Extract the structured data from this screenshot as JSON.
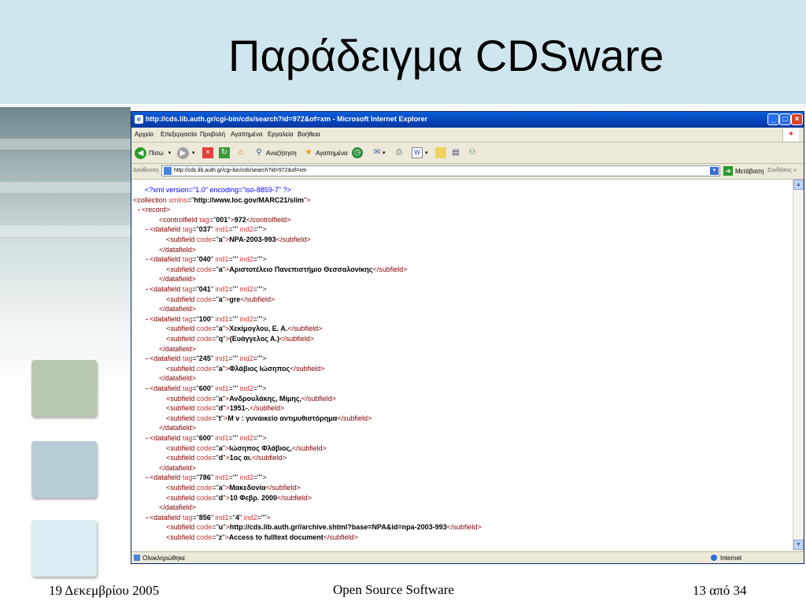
{
  "slide": {
    "title": "Παράδειγμα CDSware",
    "footer_left": "19 Δεκεμβρίου 2005",
    "footer_center": "Open Source Software",
    "footer_right": "13 από 34"
  },
  "browser": {
    "title": "http://cds.lib.auth.gr/cgi-bin/cds/search?id=972&of=xm - Microsoft Internet Explorer",
    "menu": [
      "Αρχείο",
      "Επεξεργασία",
      "Προβολή",
      "Αγαπημένα",
      "Εργαλεία",
      "Βοήθεια"
    ],
    "toolbar": {
      "back_label": "Πίσω",
      "search_label": "Αναζήτηση",
      "favorites_label": "Αγαπημένα"
    },
    "address": {
      "label": "Διεύθυνση",
      "value": "http://cds.lib.auth.gr/cgi-bin/cds/search?id=972&of=xm",
      "go_label": "Μετάβαση",
      "links_label": "Συνδέσεις"
    },
    "status": {
      "left": "Ολοκληρώθηκε",
      "zone": "Internet"
    }
  },
  "xml_lines": [
    {
      "indent": 1,
      "marker": "",
      "html": "<span class=\"pi\">&lt;?xml version=\"1.0\" encoding=\"iso-8859-7\" ?&gt;</span>"
    },
    {
      "indent": 0,
      "marker": "-",
      "html": "<span class=\"t\">&lt;collection</span> <span class=\"a\">xmlns</span>=\"<span class=\"v\">http://www.loc.gov/MARC21/slim</span>\"<span class=\"t\">&gt;</span>"
    },
    {
      "indent": 1,
      "marker": "-",
      "html": "<span class=\"t\">&lt;record&gt;</span>"
    },
    {
      "indent": 3,
      "marker": "",
      "html": "<span class=\"t\">&lt;controlfield</span> <span class=\"a\">tag</span>=\"<span class=\"v\">001</span>\"<span class=\"t\">&gt;</span><span class=\"tx\">972</span><span class=\"t\">&lt;/controlfield&gt;</span>"
    },
    {
      "indent": 2,
      "marker": "-",
      "html": "<span class=\"t\">&lt;datafield</span> <span class=\"a\">tag</span>=\"<span class=\"v\">037</span>\" <span class=\"a\">ind1</span>=\"\" <span class=\"a\">ind2</span>=\"\"<span class=\"t\">&gt;</span>"
    },
    {
      "indent": 4,
      "marker": "",
      "html": "<span class=\"t\">&lt;subfield</span> <span class=\"a\">code</span>=\"<span class=\"v\">a</span>\"<span class=\"t\">&gt;</span><span class=\"tx\">NPA-2003-993</span><span class=\"t\">&lt;/subfield&gt;</span>"
    },
    {
      "indent": 3,
      "marker": "",
      "html": "<span class=\"t\">&lt;/datafield&gt;</span>"
    },
    {
      "indent": 2,
      "marker": "-",
      "html": "<span class=\"t\">&lt;datafield</span> <span class=\"a\">tag</span>=\"<span class=\"v\">040</span>\" <span class=\"a\">ind1</span>=\"\" <span class=\"a\">ind2</span>=\"\"<span class=\"t\">&gt;</span>"
    },
    {
      "indent": 4,
      "marker": "",
      "html": "<span class=\"t\">&lt;subfield</span> <span class=\"a\">code</span>=\"<span class=\"v\">a</span>\"<span class=\"t\">&gt;</span><span class=\"tx\">Αριστοτέλειο Πανεπιστήμιο Θεσσαλονίκης</span><span class=\"t\">&lt;/subfield&gt;</span>"
    },
    {
      "indent": 3,
      "marker": "",
      "html": "<span class=\"t\">&lt;/datafield&gt;</span>"
    },
    {
      "indent": 2,
      "marker": "-",
      "html": "<span class=\"t\">&lt;datafield</span> <span class=\"a\">tag</span>=\"<span class=\"v\">041</span>\" <span class=\"a\">ind1</span>=\"\" <span class=\"a\">ind2</span>=\"\"<span class=\"t\">&gt;</span>"
    },
    {
      "indent": 4,
      "marker": "",
      "html": "<span class=\"t\">&lt;subfield</span> <span class=\"a\">code</span>=\"<span class=\"v\">a</span>\"<span class=\"t\">&gt;</span><span class=\"tx\">gre</span><span class=\"t\">&lt;/subfield&gt;</span>"
    },
    {
      "indent": 3,
      "marker": "",
      "html": "<span class=\"t\">&lt;/datafield&gt;</span>"
    },
    {
      "indent": 2,
      "marker": "-",
      "html": "<span class=\"t\">&lt;datafield</span> <span class=\"a\">tag</span>=\"<span class=\"v\">100</span>\" <span class=\"a\">ind1</span>=\"\" <span class=\"a\">ind2</span>=\"\"<span class=\"t\">&gt;</span>"
    },
    {
      "indent": 4,
      "marker": "",
      "html": "<span class=\"t\">&lt;subfield</span> <span class=\"a\">code</span>=\"<span class=\"v\">a</span>\"<span class=\"t\">&gt;</span><span class=\"tx\">Χεκίμογλου, Ε. Α.</span><span class=\"t\">&lt;/subfield&gt;</span>"
    },
    {
      "indent": 4,
      "marker": "",
      "html": "<span class=\"t\">&lt;subfield</span> <span class=\"a\">code</span>=\"<span class=\"v\">q</span>\"<span class=\"t\">&gt;</span><span class=\"tx\">(Ευάγγελος Α.)</span><span class=\"t\">&lt;/subfield&gt;</span>"
    },
    {
      "indent": 3,
      "marker": "",
      "html": "<span class=\"t\">&lt;/datafield&gt;</span>"
    },
    {
      "indent": 2,
      "marker": "-",
      "html": "<span class=\"t\">&lt;datafield</span> <span class=\"a\">tag</span>=\"<span class=\"v\">245</span>\" <span class=\"a\">ind1</span>=\"\" <span class=\"a\">ind2</span>=\"\"<span class=\"t\">&gt;</span>"
    },
    {
      "indent": 4,
      "marker": "",
      "html": "<span class=\"t\">&lt;subfield</span> <span class=\"a\">code</span>=\"<span class=\"v\">a</span>\"<span class=\"t\">&gt;</span><span class=\"tx\">Φλάβιος Ιώσηπος</span><span class=\"t\">&lt;/subfield&gt;</span>"
    },
    {
      "indent": 3,
      "marker": "",
      "html": "<span class=\"t\">&lt;/datafield&gt;</span>"
    },
    {
      "indent": 2,
      "marker": "-",
      "html": "<span class=\"t\">&lt;datafield</span> <span class=\"a\">tag</span>=\"<span class=\"v\">600</span>\" <span class=\"a\">ind1</span>=\"\" <span class=\"a\">ind2</span>=\"\"<span class=\"t\">&gt;</span>"
    },
    {
      "indent": 4,
      "marker": "",
      "html": "<span class=\"t\">&lt;subfield</span> <span class=\"a\">code</span>=\"<span class=\"v\">a</span>\"<span class=\"t\">&gt;</span><span class=\"tx\">Ανδρουλάκης, Μίμης,</span><span class=\"t\">&lt;/subfield&gt;</span>"
    },
    {
      "indent": 4,
      "marker": "",
      "html": "<span class=\"t\">&lt;subfield</span> <span class=\"a\">code</span>=\"<span class=\"v\">d</span>\"<span class=\"t\">&gt;</span><span class=\"tx\">1951-.</span><span class=\"t\">&lt;/subfield&gt;</span>"
    },
    {
      "indent": 4,
      "marker": "",
      "html": "<span class=\"t\">&lt;subfield</span> <span class=\"a\">code</span>=\"<span class=\"v\">t</span>\"<span class=\"t\">&gt;</span><span class=\"tx\">Μ ν : γυναικείο αντιμυθιστόρημα</span><span class=\"t\">&lt;/subfield&gt;</span>"
    },
    {
      "indent": 3,
      "marker": "",
      "html": "<span class=\"t\">&lt;/datafield&gt;</span>"
    },
    {
      "indent": 2,
      "marker": "-",
      "html": "<span class=\"t\">&lt;datafield</span> <span class=\"a\">tag</span>=\"<span class=\"v\">600</span>\" <span class=\"a\">ind1</span>=\"\" <span class=\"a\">ind2</span>=\"\"<span class=\"t\">&gt;</span>"
    },
    {
      "indent": 4,
      "marker": "",
      "html": "<span class=\"t\">&lt;subfield</span> <span class=\"a\">code</span>=\"<span class=\"v\">a</span>\"<span class=\"t\">&gt;</span><span class=\"tx\">Ιώσηπος Φλάβιος,</span><span class=\"t\">&lt;/subfield&gt;</span>"
    },
    {
      "indent": 4,
      "marker": "",
      "html": "<span class=\"t\">&lt;subfield</span> <span class=\"a\">code</span>=\"<span class=\"v\">d</span>\"<span class=\"t\">&gt;</span><span class=\"tx\">1ος αι.</span><span class=\"t\">&lt;/subfield&gt;</span>"
    },
    {
      "indent": 3,
      "marker": "",
      "html": "<span class=\"t\">&lt;/datafield&gt;</span>"
    },
    {
      "indent": 2,
      "marker": "-",
      "html": "<span class=\"t\">&lt;datafield</span> <span class=\"a\">tag</span>=\"<span class=\"v\">786</span>\" <span class=\"a\">ind1</span>=\"\" <span class=\"a\">ind2</span>=\"\"<span class=\"t\">&gt;</span>"
    },
    {
      "indent": 4,
      "marker": "",
      "html": "<span class=\"t\">&lt;subfield</span> <span class=\"a\">code</span>=\"<span class=\"v\">a</span>\"<span class=\"t\">&gt;</span><span class=\"tx\">Μακεδονία</span><span class=\"t\">&lt;/subfield&gt;</span>"
    },
    {
      "indent": 4,
      "marker": "",
      "html": "<span class=\"t\">&lt;subfield</span> <span class=\"a\">code</span>=\"<span class=\"v\">d</span>\"<span class=\"t\">&gt;</span><span class=\"tx\">10 Φεβρ. 2000</span><span class=\"t\">&lt;/subfield&gt;</span>"
    },
    {
      "indent": 3,
      "marker": "",
      "html": "<span class=\"t\">&lt;/datafield&gt;</span>"
    },
    {
      "indent": 2,
      "marker": "-",
      "html": "<span class=\"t\">&lt;datafield</span> <span class=\"a\">tag</span>=\"<span class=\"v\">856</span>\" <span class=\"a\">ind1</span>=\"<span class=\"v\">4</span>\" <span class=\"a\">ind2</span>=\"\"<span class=\"t\">&gt;</span>"
    },
    {
      "indent": 4,
      "marker": "",
      "html": "<span class=\"t\">&lt;subfield</span> <span class=\"a\">code</span>=\"<span class=\"v\">u</span>\"<span class=\"t\">&gt;</span><span class=\"tx\">http://cds.lib.auth.gr//archive.shtml?base=NPA&amp;id=npa-2003-993</span><span class=\"t\">&lt;/subfield&gt;</span>"
    },
    {
      "indent": 4,
      "marker": "",
      "html": "<span class=\"t\">&lt;subfield</span> <span class=\"a\">code</span>=\"<span class=\"v\">z</span>\"<span class=\"t\">&gt;</span><span class=\"tx\">Access to fulltext document</span><span class=\"t\">&lt;/subfield&gt;</span>"
    }
  ]
}
